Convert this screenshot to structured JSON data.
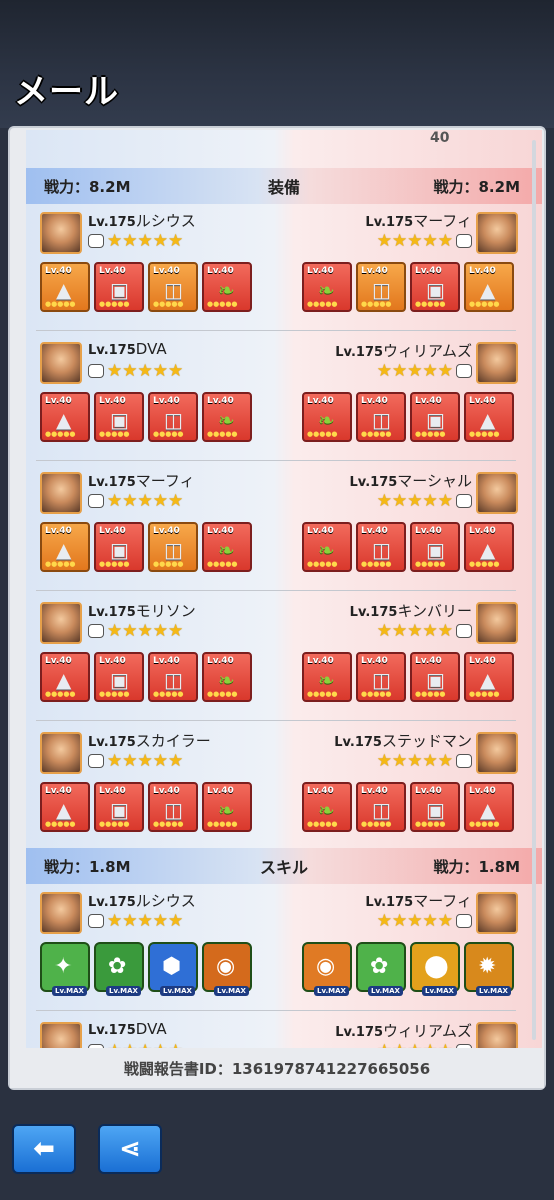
{
  "header": {
    "title": "メール"
  },
  "stub": {
    "number": "40"
  },
  "equip_section": {
    "left_power": "戦力：8.2M",
    "title": "装備",
    "right_power": "戦力：8.2M"
  },
  "skill_section": {
    "left_power": "戦力：1.8M",
    "title": "スキル",
    "right_power": "戦力：1.8M"
  },
  "equip_rows": [
    {
      "left_lv": "Lv.175",
      "left_name": "ルシウス",
      "right_lv": "Lv.175",
      "right_name": "マーフィ"
    },
    {
      "left_lv": "Lv.175",
      "left_name": "DVA",
      "right_lv": "Lv.175",
      "right_name": "ウィリアムズ"
    },
    {
      "left_lv": "Lv.175",
      "left_name": "マーフィ",
      "right_lv": "Lv.175",
      "right_name": "マーシャル"
    },
    {
      "left_lv": "Lv.175",
      "left_name": "モリソン",
      "right_lv": "Lv.175",
      "right_name": "キンバリー"
    },
    {
      "left_lv": "Lv.175",
      "left_name": "スカイラー",
      "right_lv": "Lv.175",
      "right_name": "ステッドマン"
    }
  ],
  "skill_rows": [
    {
      "left_lv": "Lv.175",
      "left_name": "ルシウス",
      "right_lv": "Lv.175",
      "right_name": "マーフィ"
    },
    {
      "left_lv": "Lv.175",
      "left_name": "DVA",
      "right_lv": "Lv.175",
      "right_name": "ウィリアムズ"
    }
  ],
  "equip_level": "Lv.40",
  "skill_level": "Lv.MAX",
  "star_rating": 5,
  "footer": {
    "report_id": "戦闘報告書ID：1361978741227665056"
  },
  "buttons": {
    "back_icon": "back-arrow-icon",
    "share_icon": "share-icon"
  },
  "colors": {
    "accent_blue": "#1a6fd4",
    "star": "#f5b917",
    "equip_red": "#d9382c",
    "equip_orange": "#e2771d"
  }
}
